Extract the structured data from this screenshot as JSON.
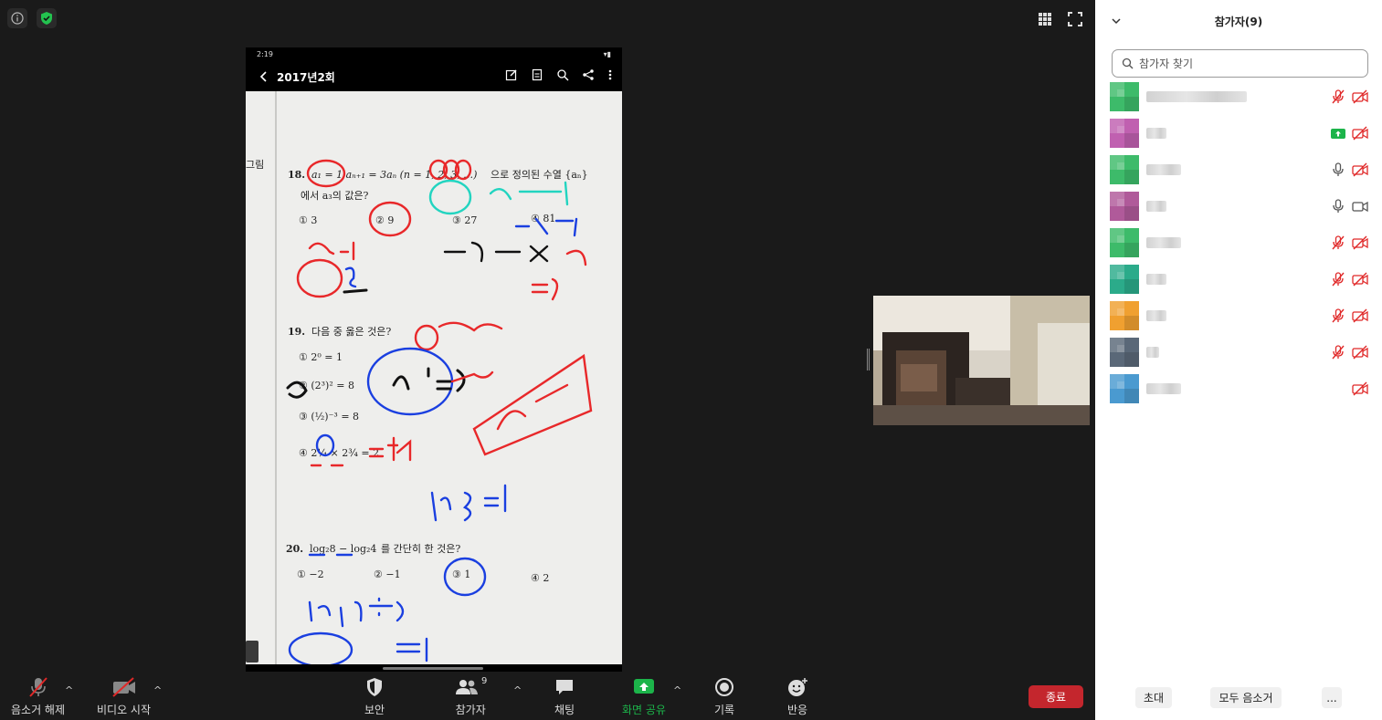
{
  "phone": {
    "status_time": "2:19",
    "title": "2017년2회"
  },
  "paper": {
    "side_label": "그림",
    "q18_num": "18.",
    "q18_text": "으로 정의된 수열 {aₙ}",
    "q18_text2": "에서 a₃의 값은?",
    "q18_choices": [
      "① 3",
      "② 9",
      "③ 27",
      "④ 81"
    ],
    "q19_num": "19.",
    "q19_text": "다음 중 옳은 것은?",
    "q20_num": "20.",
    "q20_text": "를 간단히 한 것은?",
    "q20_choices": [
      "① −2",
      "② −1",
      "③ 1",
      "④ 2"
    ]
  },
  "toolbar": {
    "mute_label": "음소거 해제",
    "video_label": "비디오 시작",
    "security_label": "보안",
    "participants_label": "참가자",
    "participants_count": "9",
    "chat_label": "채팅",
    "share_label": "화면 공유",
    "record_label": "기록",
    "reactions_label": "반응",
    "end_label": "종료"
  },
  "sidebar": {
    "title": "참가자(9)",
    "search_placeholder": "참가자 찾기",
    "invite_label": "초대",
    "mute_all_label": "모두 음소거",
    "more_label": "...",
    "participants": [
      {
        "avatar_color": "#3dbb6a",
        "mic": "muted",
        "video": "off"
      },
      {
        "avatar_color": "#c060b0",
        "mic": "sharing",
        "video": "off"
      },
      {
        "avatar_color": "#3dbb6a",
        "mic": "on",
        "video": "off"
      },
      {
        "avatar_color": "#b05a9a",
        "mic": "on",
        "video": "on"
      },
      {
        "avatar_color": "#3dbb6a",
        "mic": "muted",
        "video": "off"
      },
      {
        "avatar_color": "#2bab8a",
        "mic": "muted",
        "video": "off"
      },
      {
        "avatar_color": "#f0a030",
        "mic": "muted",
        "video": "off"
      },
      {
        "avatar_color": "#5a6878",
        "mic": "muted",
        "video": "off"
      },
      {
        "avatar_color": "#4a9ad0",
        "mic": "none",
        "video": "off"
      }
    ]
  },
  "colors": {
    "end_red": "#c4262d",
    "share_green": "#1cb44a",
    "muted_red": "#e02828"
  }
}
